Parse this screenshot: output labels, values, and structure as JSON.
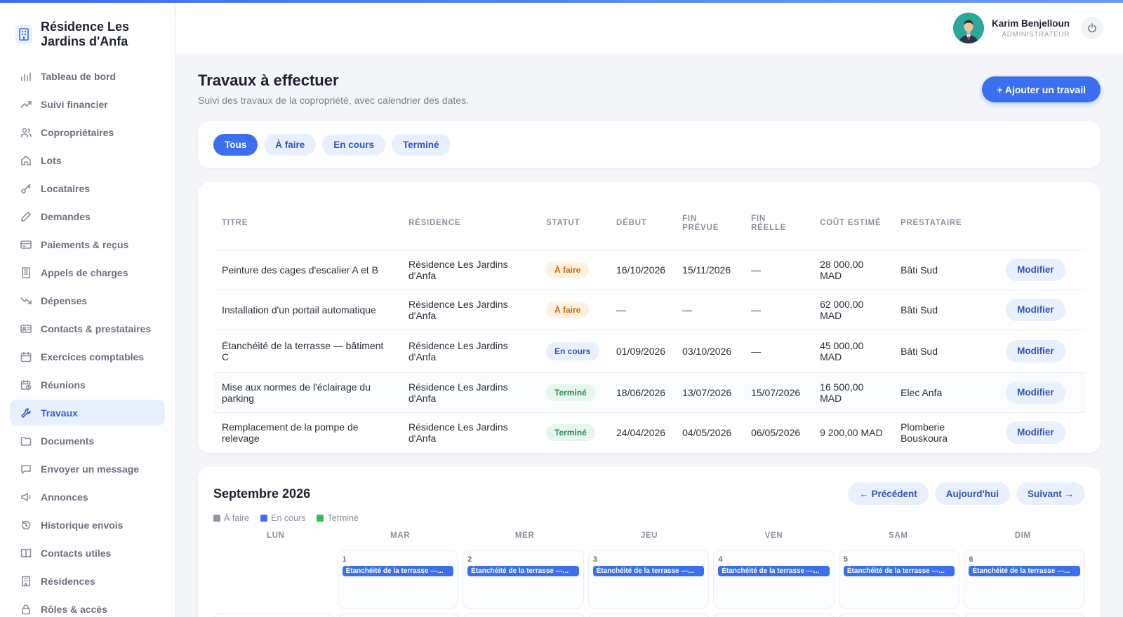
{
  "brand": {
    "name": "Résidence Les Jardins d'Anfa"
  },
  "sidebar": {
    "items": [
      {
        "label": "Tableau de bord",
        "icon": "bar-chart-icon"
      },
      {
        "label": "Suivi financier",
        "icon": "trending-up-icon"
      },
      {
        "label": "Copropriétaires",
        "icon": "users-icon"
      },
      {
        "label": "Lots",
        "icon": "home-icon"
      },
      {
        "label": "Locataires",
        "icon": "key-icon"
      },
      {
        "label": "Demandes",
        "icon": "pencil-icon"
      },
      {
        "label": "Paiements & reçus",
        "icon": "credit-card-icon"
      },
      {
        "label": "Appels de charges",
        "icon": "receipt-icon"
      },
      {
        "label": "Dépenses",
        "icon": "trending-down-icon"
      },
      {
        "label": "Contacts & prestataires",
        "icon": "id-card-icon"
      },
      {
        "label": "Exercices comptables",
        "icon": "calendar-icon"
      },
      {
        "label": "Réunions",
        "icon": "calendar-clock-icon"
      },
      {
        "label": "Travaux",
        "icon": "wrench-icon"
      },
      {
        "label": "Documents",
        "icon": "folder-icon"
      },
      {
        "label": "Envoyer un message",
        "icon": "message-icon"
      },
      {
        "label": "Annonces",
        "icon": "megaphone-icon"
      },
      {
        "label": "Historique envois",
        "icon": "history-icon"
      },
      {
        "label": "Contacts utiles",
        "icon": "book-icon"
      },
      {
        "label": "Résidences",
        "icon": "building-icon"
      },
      {
        "label": "Rôles & accès",
        "icon": "lock-icon"
      }
    ],
    "active": "Travaux"
  },
  "user": {
    "name": "Karim Benjelloun",
    "role": "ADMINISTRATEUR"
  },
  "page": {
    "title": "Travaux à effectuer",
    "subtitle": "Suivi des travaux de la copropriété, avec calendrier des dates.",
    "add_button": "+ Ajouter un travail"
  },
  "filters": [
    "Tous",
    "À faire",
    "En cours",
    "Terminé"
  ],
  "table": {
    "headers": [
      "Titre",
      "Résidence",
      "Statut",
      "Début",
      "Fin prévue",
      "Fin réelle",
      "Coût estimé",
      "Prestataire",
      ""
    ],
    "action_label": "Modifier",
    "rows": [
      {
        "titre": "Peinture des cages d'escalier A et B",
        "residence": "Résidence Les Jardins d'Anfa",
        "statut": "À faire",
        "debut": "16/10/2026",
        "fin_prevue": "15/11/2026",
        "fin_reelle": "—",
        "cout": "28 000,00 MAD",
        "prestataire": "Bâti Sud"
      },
      {
        "titre": "Installation d'un portail automatique",
        "residence": "Résidence Les Jardins d'Anfa",
        "statut": "À faire",
        "debut": "—",
        "fin_prevue": "—",
        "fin_reelle": "—",
        "cout": "62 000,00 MAD",
        "prestataire": "Bâti Sud"
      },
      {
        "titre": "Étanchéité de la terrasse — bâtiment C",
        "residence": "Résidence Les Jardins d'Anfa",
        "statut": "En cours",
        "debut": "01/09/2026",
        "fin_prevue": "03/10/2026",
        "fin_reelle": "—",
        "cout": "45 000,00 MAD",
        "prestataire": "Bâti Sud"
      },
      {
        "titre": "Mise aux normes de l'éclairage du parking",
        "residence": "Résidence Les Jardins d'Anfa",
        "statut": "Terminé",
        "debut": "18/06/2026",
        "fin_prevue": "13/07/2026",
        "fin_reelle": "15/07/2026",
        "cout": "16 500,00 MAD",
        "prestataire": "Elec Anfa"
      },
      {
        "titre": "Remplacement de la pompe de relevage",
        "residence": "Résidence Les Jardins d'Anfa",
        "statut": "Terminé",
        "debut": "24/04/2026",
        "fin_prevue": "04/05/2026",
        "fin_reelle": "06/05/2026",
        "cout": "9 200,00 MAD",
        "prestataire": "Plomberie Bouskoura"
      }
    ]
  },
  "calendar": {
    "month": "Septembre 2026",
    "prev": "← Précédent",
    "today": "Aujourd'hui",
    "next": "Suivant →",
    "legend": [
      {
        "label": "À faire",
        "color": "#8f96a3"
      },
      {
        "label": "En cours",
        "color": "#3a6ff0"
      },
      {
        "label": "Terminé",
        "color": "#2fbf5a"
      }
    ],
    "days": [
      "LUN",
      "MAR",
      "MER",
      "JEU",
      "VEN",
      "SAM",
      "DIM"
    ],
    "cells": [
      {
        "num": "",
        "event": ""
      },
      {
        "num": "1",
        "event": "Étanchéité de la terrasse —..."
      },
      {
        "num": "2",
        "event": "Étanchéité de la terrasse —..."
      },
      {
        "num": "3",
        "event": "Étanchéité de la terrasse —..."
      },
      {
        "num": "4",
        "event": "Étanchéité de la terrasse —..."
      },
      {
        "num": "5",
        "event": "Étanchéité de la terrasse —..."
      },
      {
        "num": "6",
        "event": "Étanchéité de la terrasse —..."
      }
    ]
  },
  "colors": {
    "accent": "#3a6ff0",
    "todo": "#c86a0c",
    "progress": "#2f56b8",
    "done": "#2d8a4e"
  }
}
